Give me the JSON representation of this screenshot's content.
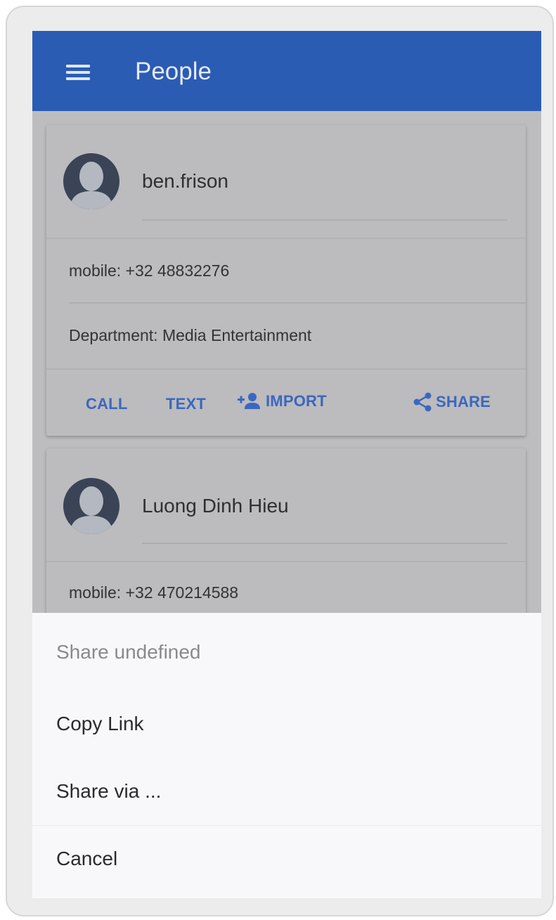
{
  "app_bar": {
    "title": "People",
    "menu_icon": "hamburger-menu-icon",
    "color": "#2a5cb4"
  },
  "contacts": [
    {
      "name": "ben.frison",
      "mobile": "mobile: +32 48832276",
      "department": "Department: Media Entertainment",
      "actions": {
        "call": "CALL",
        "text": "TEXT",
        "import": "IMPORT",
        "share": "SHARE"
      }
    },
    {
      "name": "Luong Dinh Hieu",
      "mobile": "mobile: +32 470214588"
    }
  ],
  "share_sheet": {
    "title": "Share undefined",
    "items": [
      "Copy Link",
      "Share via ...",
      "Cancel"
    ]
  },
  "colors": {
    "accent": "#3b67bf",
    "avatar_bg": "#3a4456",
    "avatar_figure": "#b4b8c0",
    "scrim": "#bdbcbe",
    "sheet_bg": "#f8f7fa"
  },
  "icons": {
    "import": "person-add-icon",
    "share": "share-icon",
    "avatar": "default-avatar-icon"
  }
}
